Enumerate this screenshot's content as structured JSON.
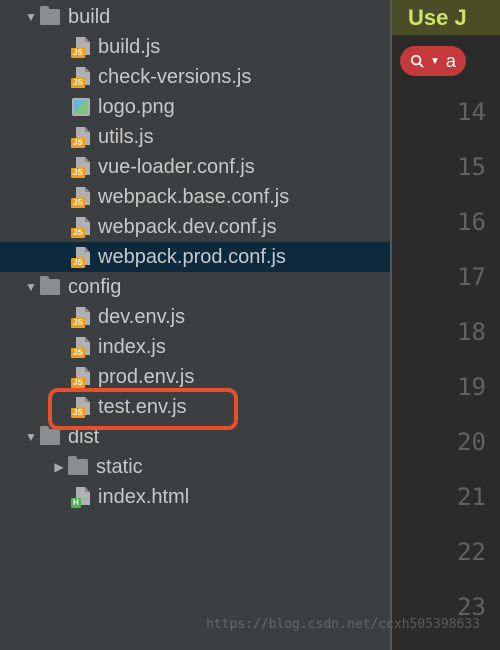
{
  "tree": {
    "build": {
      "name": "build",
      "expanded": true,
      "files": [
        {
          "name": "build.js",
          "type": "js"
        },
        {
          "name": "check-versions.js",
          "type": "js"
        },
        {
          "name": "logo.png",
          "type": "img"
        },
        {
          "name": "utils.js",
          "type": "js"
        },
        {
          "name": "vue-loader.conf.js",
          "type": "js"
        },
        {
          "name": "webpack.base.conf.js",
          "type": "js"
        },
        {
          "name": "webpack.dev.conf.js",
          "type": "js"
        },
        {
          "name": "webpack.prod.conf.js",
          "type": "js",
          "selected": true
        }
      ]
    },
    "config": {
      "name": "config",
      "expanded": true,
      "files": [
        {
          "name": "dev.env.js",
          "type": "js"
        },
        {
          "name": "index.js",
          "type": "js",
          "highlighted": true
        },
        {
          "name": "prod.env.js",
          "type": "js"
        },
        {
          "name": "test.env.js",
          "type": "js"
        }
      ]
    },
    "dist": {
      "name": "dist",
      "expanded": true,
      "children": [
        {
          "name": "static",
          "type": "folder"
        },
        {
          "name": "index.html",
          "type": "html"
        }
      ]
    }
  },
  "editor": {
    "header": "Use J",
    "search_text": "a",
    "line_start": 14,
    "line_end": 23
  },
  "watermark": "https://blog.csdn.net/ccxh505398633"
}
